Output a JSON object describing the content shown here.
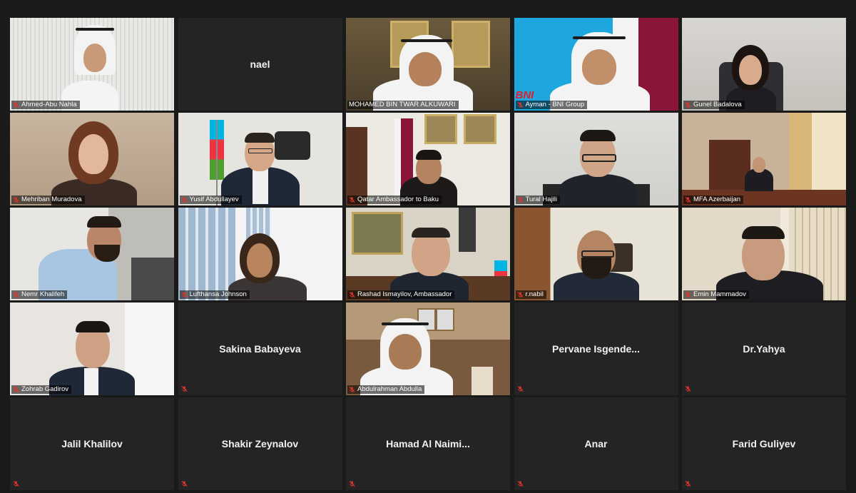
{
  "participants": [
    {
      "name": "Ahmed-Abu Nahla",
      "video": true
    },
    {
      "name": "nael",
      "video": false
    },
    {
      "name": "MOHAMED BIN TWAR ALKUWARI",
      "video": true,
      "active_speaker": true
    },
    {
      "name": "Ayman - BNI Group",
      "video": true
    },
    {
      "name": "Gunel Badalova",
      "video": true
    },
    {
      "name": "Mehriban Muradova",
      "video": true
    },
    {
      "name": "Yusif Abdullayev",
      "video": true
    },
    {
      "name": "Qatar Ambassador to Baku",
      "video": true
    },
    {
      "name": "Tural Hajili",
      "video": true
    },
    {
      "name": "MFA Azerbaijan",
      "video": true
    },
    {
      "name": "Nemr Khalifeh",
      "video": true
    },
    {
      "name": "Lufthansa Johnson",
      "video": true
    },
    {
      "name": "Rashad Ismayilov, Ambassador",
      "video": true
    },
    {
      "name": "r.nabil",
      "video": true
    },
    {
      "name": "Emin Mammadov",
      "video": true
    },
    {
      "name": "Zohrab Gadirov",
      "video": true
    },
    {
      "name": "Sakina Babayeva",
      "video": false
    },
    {
      "name": "Abdulrahman Abdulla",
      "video": true
    },
    {
      "name": "Pervane Isgende...",
      "video": false
    },
    {
      "name": "Dr.Yahya",
      "video": false
    },
    {
      "name": "Jalil Khalilov",
      "video": false
    },
    {
      "name": "Shakir Zeynalov",
      "video": false
    },
    {
      "name": "Hamad Al Naimi...",
      "video": false
    },
    {
      "name": "Anar",
      "video": false
    },
    {
      "name": "Farid Guliyev",
      "video": false
    }
  ],
  "ayman_tile_logo": "BNI",
  "icons": {
    "muted": "muted-mic-icon"
  },
  "colors": {
    "active_speaker_border": "#a7c53a",
    "muted_mic": "#e0352b",
    "background": "#1a1a1a"
  }
}
